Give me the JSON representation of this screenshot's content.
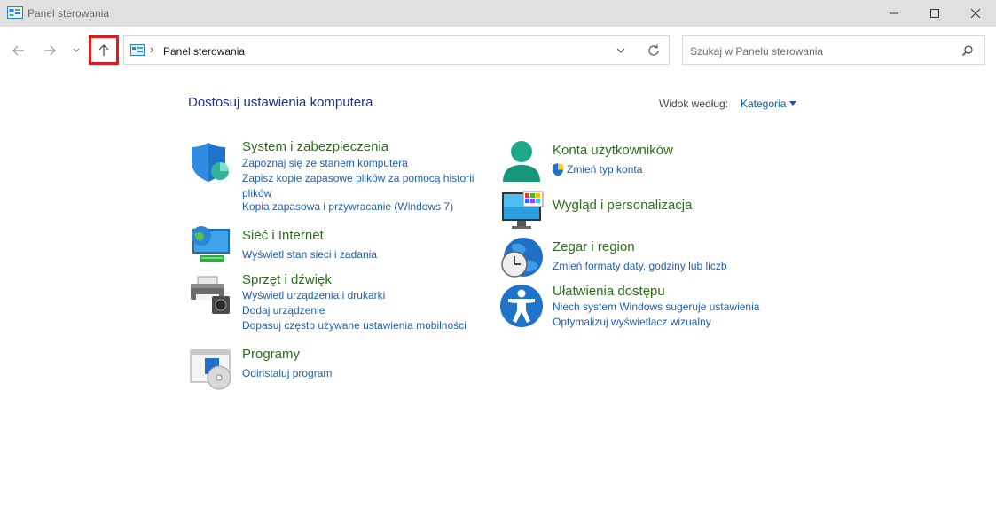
{
  "window": {
    "title": "Panel sterowania"
  },
  "address_bar": {
    "breadcrumb": "Panel sterowania"
  },
  "search": {
    "placeholder": "Szukaj w Panelu sterowania"
  },
  "main": {
    "heading": "Dostosuj ustawienia komputera",
    "view_by_label": "Widok według:",
    "view_by_value": "Kategoria"
  },
  "categories": {
    "system_security": {
      "title": "System i zabezpieczenia",
      "icon": "shield-icon",
      "links": [
        "Zapoznaj się ze stanem komputera",
        "Zapisz kopie zapasowe plików za pomocą historii plików",
        "Kopia zapasowa i przywracanie (Windows 7)"
      ]
    },
    "network": {
      "title": "Sieć i Internet",
      "icon": "network-globe-icon",
      "links": [
        "Wyświetl stan sieci i zadania"
      ]
    },
    "hardware_sound": {
      "title": "Sprzęt i dźwięk",
      "icon": "printer-icon",
      "links": [
        "Wyświetl urządzenia i drukarki",
        "Dodaj urządzenie",
        "Dopasuj często używane ustawienia mobilności"
      ]
    },
    "programs": {
      "title": "Programy",
      "icon": "programs-icon",
      "links": [
        "Odinstaluj program"
      ]
    },
    "user_accounts": {
      "title": "Konta użytkowników",
      "icon": "user-icon",
      "links": [
        "Zmień typ konta"
      ]
    },
    "appearance": {
      "title": "Wygląd i personalizacja",
      "icon": "monitor-icon",
      "links": []
    },
    "clock_region": {
      "title": "Zegar i region",
      "icon": "clock-globe-icon",
      "links": [
        "Zmień formaty daty, godziny lub liczb"
      ]
    },
    "accessibility": {
      "title": "Ułatwienia dostępu",
      "icon": "accessibility-icon",
      "links": [
        "Niech system Windows sugeruje ustawienia",
        "Optymalizuj wyświetlacz wizualny"
      ]
    }
  },
  "colors": {
    "category_title": "#2e6e1a",
    "link": "#1f5fb0",
    "heading": "#1e3287",
    "highlight_box": "#e0191e"
  }
}
